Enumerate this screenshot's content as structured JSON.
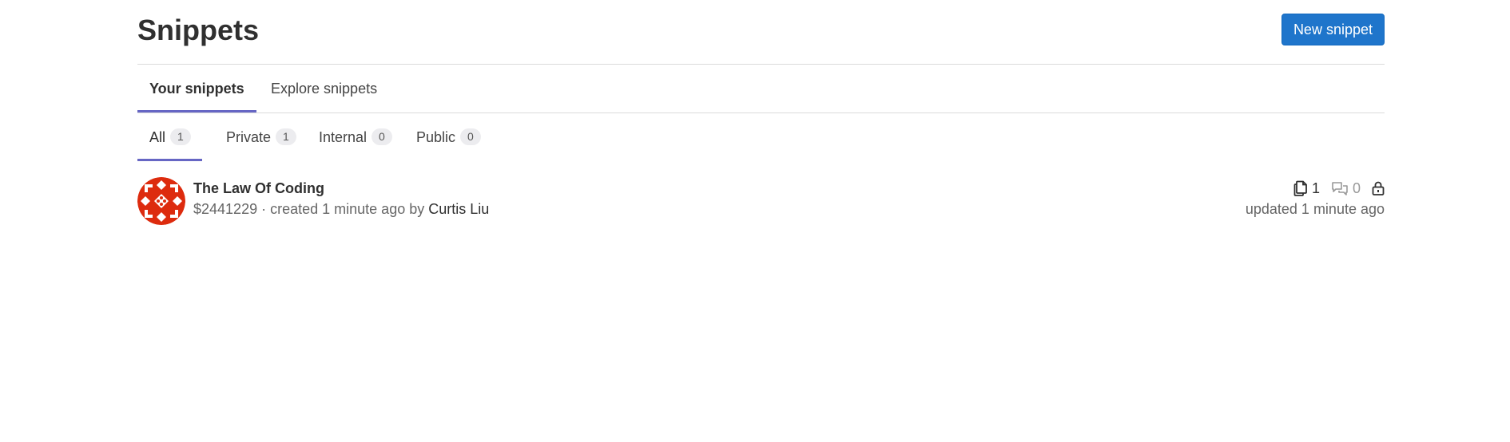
{
  "header": {
    "title": "Snippets",
    "new_button": "New snippet"
  },
  "scope_tabs": [
    {
      "label": "Your snippets",
      "active": true
    },
    {
      "label": "Explore snippets",
      "active": false
    }
  ],
  "filter_tabs": [
    {
      "label": "All",
      "count": "1",
      "active": true
    },
    {
      "label": "Private",
      "count": "1",
      "active": false
    },
    {
      "label": "Internal",
      "count": "0",
      "active": false
    },
    {
      "label": "Public",
      "count": "0",
      "active": false
    }
  ],
  "snippets": [
    {
      "title": "The Law Of Coding",
      "id": "$2441229",
      "created_text": "· created 1 minute ago by",
      "author": "Curtis Liu",
      "files_count": "1",
      "comments_count": "0",
      "visibility_icon": "lock-icon",
      "updated_text": "updated 1 minute ago"
    }
  ],
  "colors": {
    "accent": "#6666c4",
    "primary_button": "#1f75cb",
    "avatar": "#dd2b0e"
  }
}
